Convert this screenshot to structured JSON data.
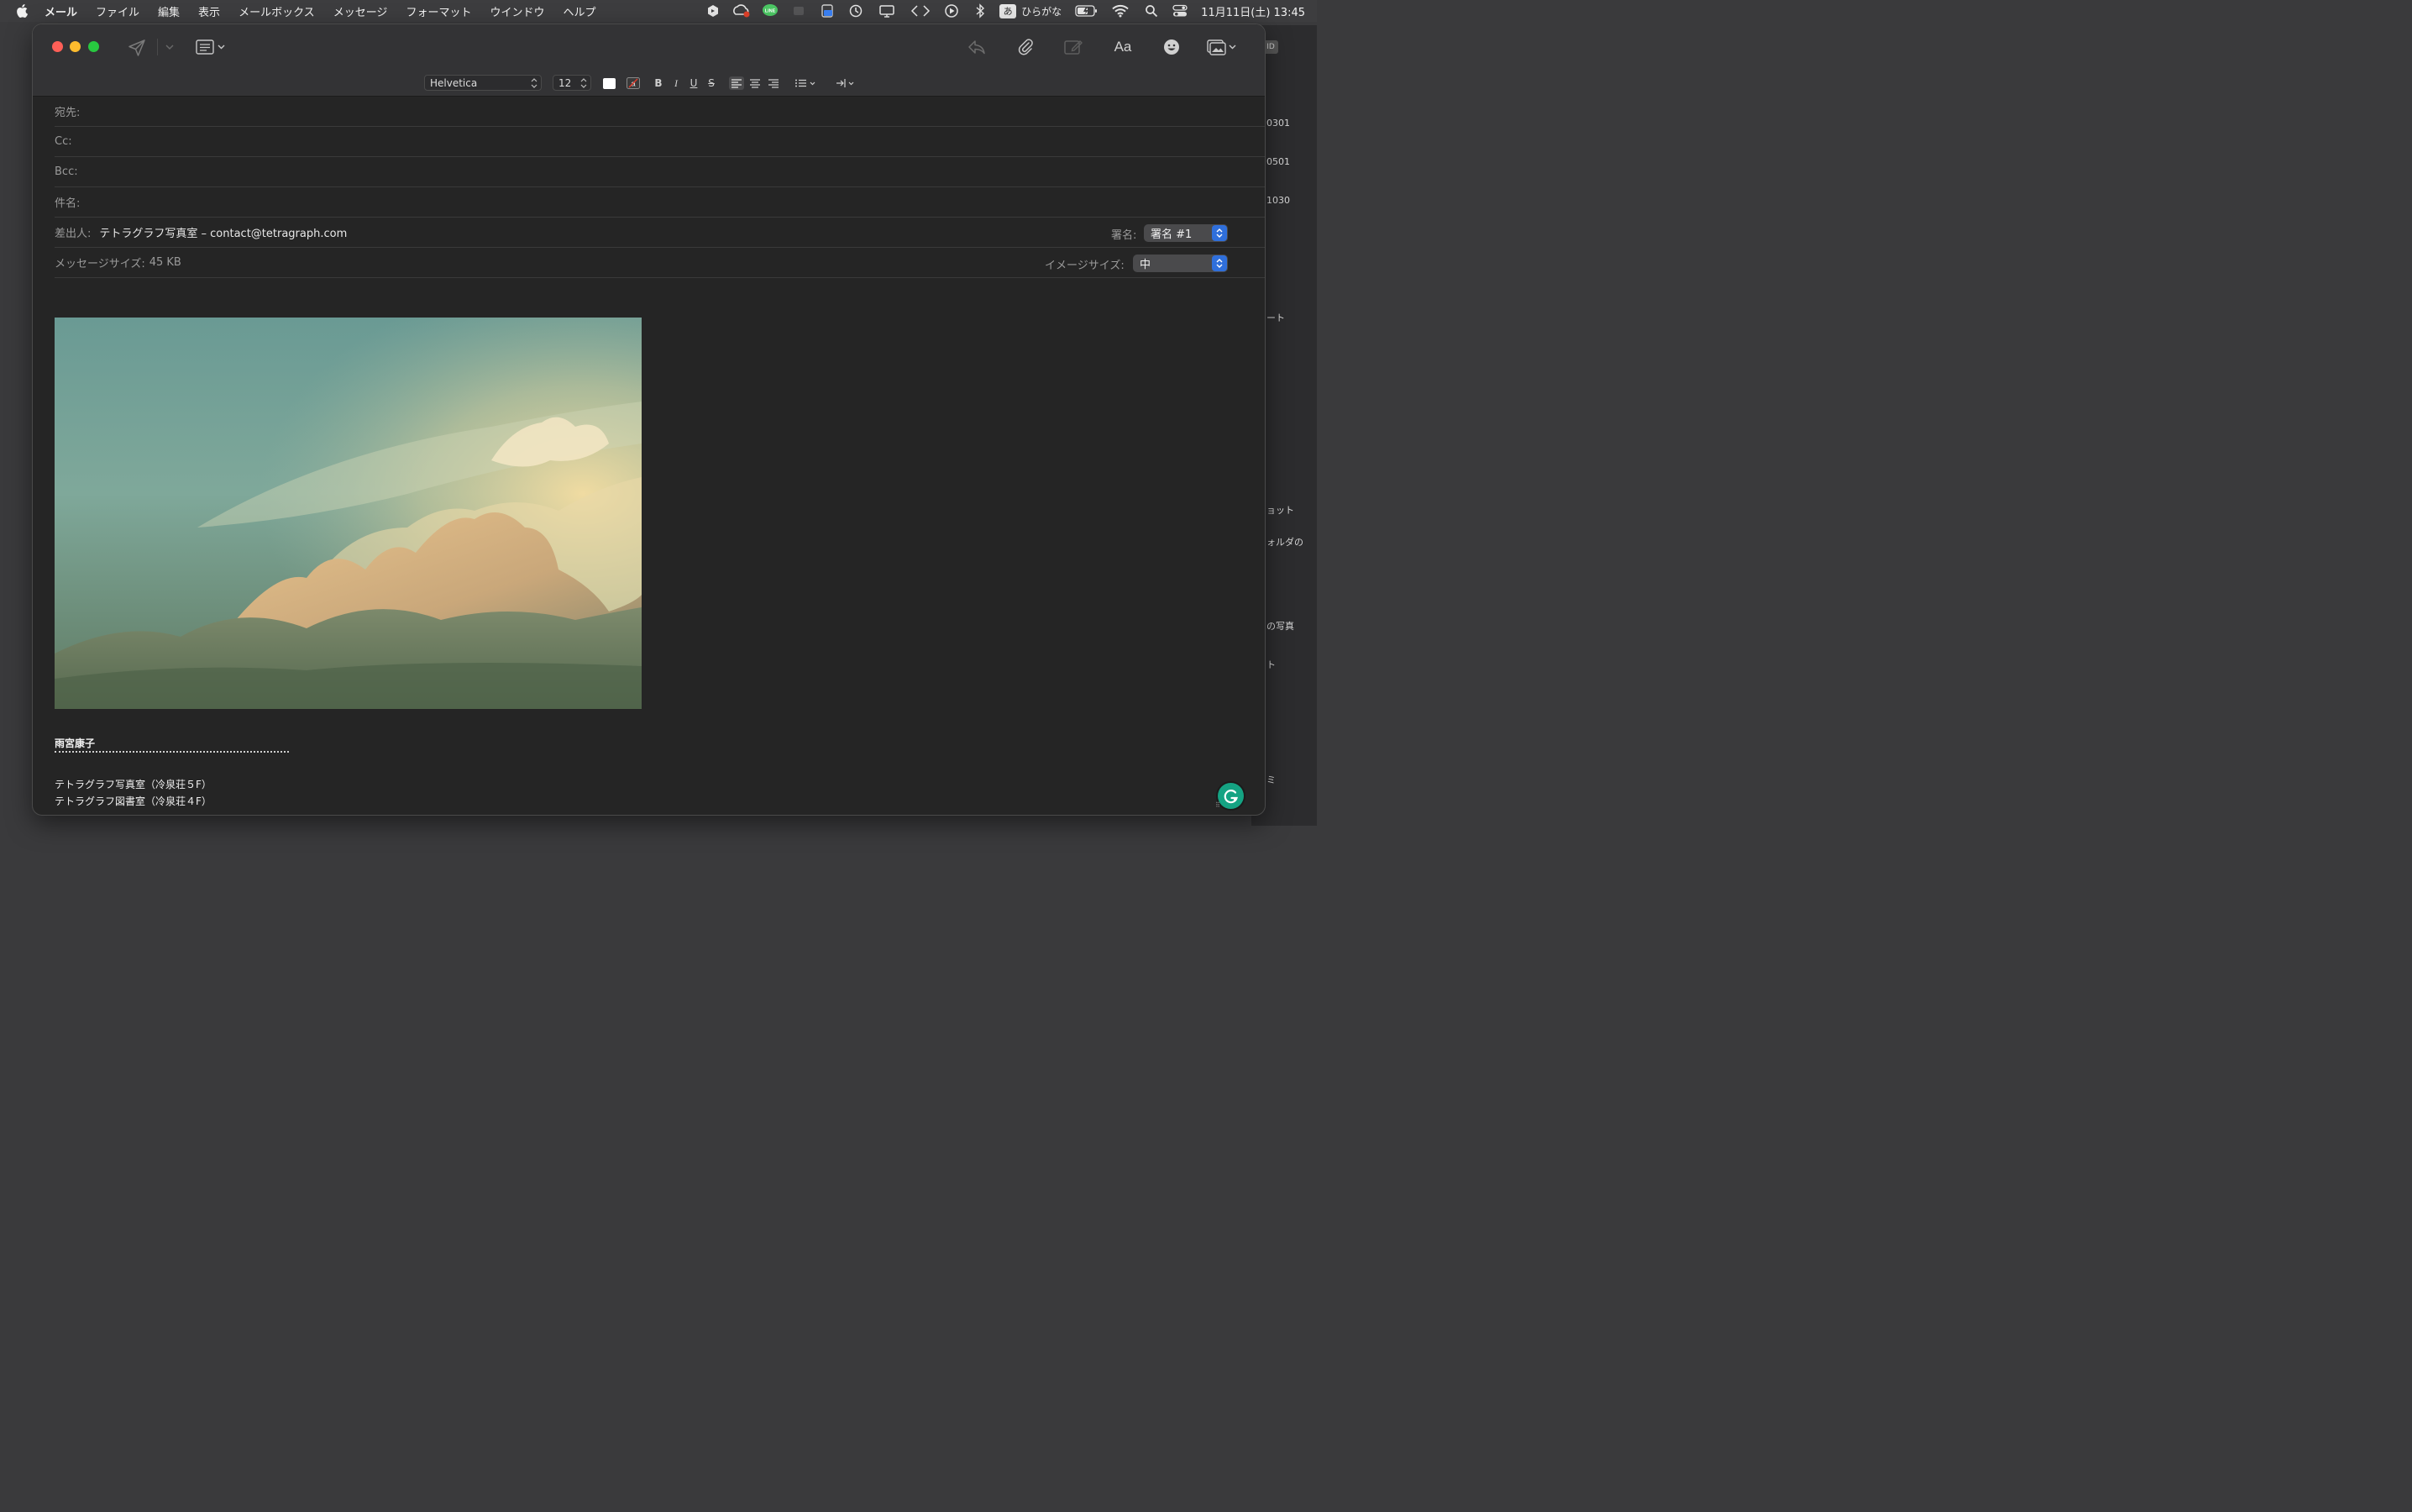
{
  "menubar": {
    "app_name": "メール",
    "items": [
      "ファイル",
      "編集",
      "表示",
      "メールボックス",
      "メッセージ",
      "フォーマット",
      "ウインドウ",
      "ヘルプ"
    ],
    "input_mode_badge": "あ",
    "input_mode_label": "ひらがな",
    "clock": "11月11日(土) 13:45",
    "status_icons": [
      "shortcuts-icon",
      "creative-cloud-icon",
      "line-icon",
      "app-icon",
      "screen-recorder-icon",
      "time-machine-icon",
      "display-icon",
      "code-icon",
      "play-icon",
      "bluetooth-icon",
      "battery-icon",
      "wifi-icon",
      "search-icon",
      "control-center-icon"
    ]
  },
  "toolbar": {
    "icons": [
      "send-icon",
      "header-fields-icon",
      "reply-icon",
      "attach-icon",
      "compose-markup-icon",
      "format-icon",
      "emoji-icon",
      "photo-browser-icon"
    ],
    "format_label": "Aa"
  },
  "format": {
    "font_family": "Helvetica",
    "font_size": "12",
    "bold": "B",
    "italic": "I",
    "underline": "U",
    "strike": "S"
  },
  "headers": {
    "to_label": "宛先:",
    "to_value": "",
    "cc_label": "Cc:",
    "cc_value": "",
    "bcc_label": "Bcc:",
    "bcc_value": "",
    "subject_label": "件名:",
    "subject_value": "",
    "from_label": "差出人:",
    "from_value": "テトラグラフ写真室 – contact@tetragraph.com",
    "signature_label": "署名:",
    "signature_value": "署名 #1",
    "size_label": "メッセージサイズ:",
    "size_value": "45 KB",
    "image_size_label": "イメージサイズ:",
    "image_size_value": "中"
  },
  "body": {
    "signature_name": "雨宮康子",
    "signature_lines": [
      "テトラグラフ写真室（冷泉荘５F）",
      "テトラグラフ図書室（冷泉荘４F）"
    ]
  },
  "background_window": {
    "texts": [
      "0301",
      "0501",
      "1030",
      "ート",
      "ョット",
      "ォルダの",
      "の写真",
      "ト",
      "ミ"
    ]
  },
  "colors": {
    "window_bg": "#252525",
    "toolbar_bg": "#333335",
    "accent_blue": "#2f6fdb",
    "grammarly_green": "#15a383"
  }
}
